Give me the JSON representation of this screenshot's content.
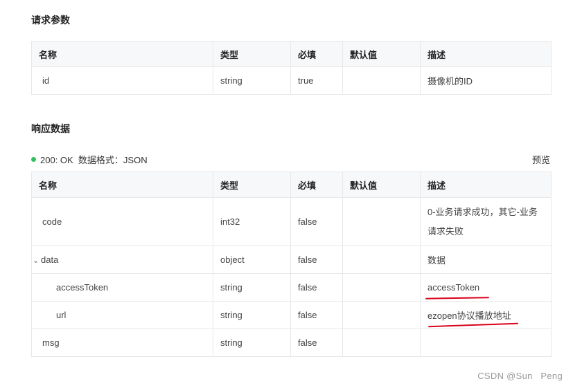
{
  "request": {
    "title": "请求参数",
    "headers": [
      "名称",
      "类型",
      "必填",
      "默认值",
      "描述"
    ],
    "rows": [
      {
        "name": "id",
        "type": "string",
        "required": "true",
        "default": "",
        "desc": "摄像机的ID"
      }
    ]
  },
  "response": {
    "title": "响应数据",
    "status_text": "200: OK  数据格式：JSON",
    "status_color": "#2fc25b",
    "preview_label": "预览",
    "headers": [
      "名称",
      "类型",
      "必填",
      "默认值",
      "描述"
    ],
    "rows": [
      {
        "name": "code",
        "type": "int32",
        "required": "false",
        "default": "",
        "desc": "0-业务请求成功，其它-业务请求失败"
      },
      {
        "name": "data",
        "type": "object",
        "required": "false",
        "default": "",
        "desc": "数据",
        "expander": "chevron-down-icon"
      },
      {
        "name": "accessToken",
        "type": "string",
        "required": "false",
        "default": "",
        "desc": "accessToken"
      },
      {
        "name": "url",
        "type": "string",
        "required": "false",
        "default": "",
        "desc": "ezopen协议播放地址"
      },
      {
        "name": "msg",
        "type": "string",
        "required": "false",
        "default": "",
        "desc": ""
      }
    ]
  },
  "annotation_color": "#d9001b",
  "watermark": "CSDN @Sun   Peng"
}
